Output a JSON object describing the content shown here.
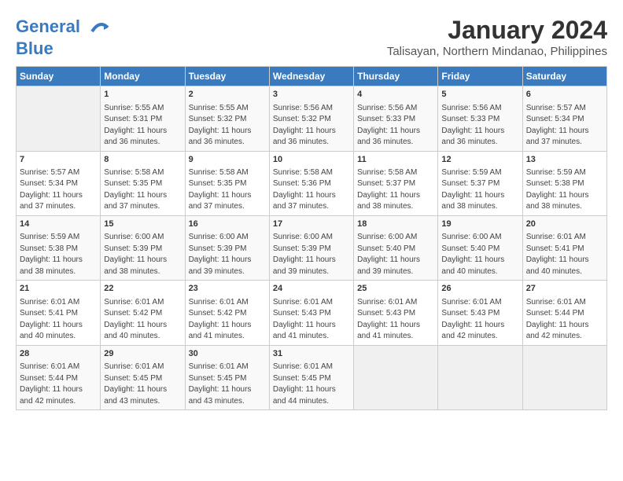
{
  "header": {
    "logo_line1": "General",
    "logo_line2": "Blue",
    "month_year": "January 2024",
    "location": "Talisayan, Northern Mindanao, Philippines"
  },
  "columns": [
    "Sunday",
    "Monday",
    "Tuesday",
    "Wednesday",
    "Thursday",
    "Friday",
    "Saturday"
  ],
  "weeks": [
    [
      {
        "num": "",
        "info": ""
      },
      {
        "num": "1",
        "info": "Sunrise: 5:55 AM\nSunset: 5:31 PM\nDaylight: 11 hours\nand 36 minutes."
      },
      {
        "num": "2",
        "info": "Sunrise: 5:55 AM\nSunset: 5:32 PM\nDaylight: 11 hours\nand 36 minutes."
      },
      {
        "num": "3",
        "info": "Sunrise: 5:56 AM\nSunset: 5:32 PM\nDaylight: 11 hours\nand 36 minutes."
      },
      {
        "num": "4",
        "info": "Sunrise: 5:56 AM\nSunset: 5:33 PM\nDaylight: 11 hours\nand 36 minutes."
      },
      {
        "num": "5",
        "info": "Sunrise: 5:56 AM\nSunset: 5:33 PM\nDaylight: 11 hours\nand 36 minutes."
      },
      {
        "num": "6",
        "info": "Sunrise: 5:57 AM\nSunset: 5:34 PM\nDaylight: 11 hours\nand 37 minutes."
      }
    ],
    [
      {
        "num": "7",
        "info": "Sunrise: 5:57 AM\nSunset: 5:34 PM\nDaylight: 11 hours\nand 37 minutes."
      },
      {
        "num": "8",
        "info": "Sunrise: 5:58 AM\nSunset: 5:35 PM\nDaylight: 11 hours\nand 37 minutes."
      },
      {
        "num": "9",
        "info": "Sunrise: 5:58 AM\nSunset: 5:35 PM\nDaylight: 11 hours\nand 37 minutes."
      },
      {
        "num": "10",
        "info": "Sunrise: 5:58 AM\nSunset: 5:36 PM\nDaylight: 11 hours\nand 37 minutes."
      },
      {
        "num": "11",
        "info": "Sunrise: 5:58 AM\nSunset: 5:37 PM\nDaylight: 11 hours\nand 38 minutes."
      },
      {
        "num": "12",
        "info": "Sunrise: 5:59 AM\nSunset: 5:37 PM\nDaylight: 11 hours\nand 38 minutes."
      },
      {
        "num": "13",
        "info": "Sunrise: 5:59 AM\nSunset: 5:38 PM\nDaylight: 11 hours\nand 38 minutes."
      }
    ],
    [
      {
        "num": "14",
        "info": "Sunrise: 5:59 AM\nSunset: 5:38 PM\nDaylight: 11 hours\nand 38 minutes."
      },
      {
        "num": "15",
        "info": "Sunrise: 6:00 AM\nSunset: 5:39 PM\nDaylight: 11 hours\nand 38 minutes."
      },
      {
        "num": "16",
        "info": "Sunrise: 6:00 AM\nSunset: 5:39 PM\nDaylight: 11 hours\nand 39 minutes."
      },
      {
        "num": "17",
        "info": "Sunrise: 6:00 AM\nSunset: 5:39 PM\nDaylight: 11 hours\nand 39 minutes."
      },
      {
        "num": "18",
        "info": "Sunrise: 6:00 AM\nSunset: 5:40 PM\nDaylight: 11 hours\nand 39 minutes."
      },
      {
        "num": "19",
        "info": "Sunrise: 6:00 AM\nSunset: 5:40 PM\nDaylight: 11 hours\nand 40 minutes."
      },
      {
        "num": "20",
        "info": "Sunrise: 6:01 AM\nSunset: 5:41 PM\nDaylight: 11 hours\nand 40 minutes."
      }
    ],
    [
      {
        "num": "21",
        "info": "Sunrise: 6:01 AM\nSunset: 5:41 PM\nDaylight: 11 hours\nand 40 minutes."
      },
      {
        "num": "22",
        "info": "Sunrise: 6:01 AM\nSunset: 5:42 PM\nDaylight: 11 hours\nand 40 minutes."
      },
      {
        "num": "23",
        "info": "Sunrise: 6:01 AM\nSunset: 5:42 PM\nDaylight: 11 hours\nand 41 minutes."
      },
      {
        "num": "24",
        "info": "Sunrise: 6:01 AM\nSunset: 5:43 PM\nDaylight: 11 hours\nand 41 minutes."
      },
      {
        "num": "25",
        "info": "Sunrise: 6:01 AM\nSunset: 5:43 PM\nDaylight: 11 hours\nand 41 minutes."
      },
      {
        "num": "26",
        "info": "Sunrise: 6:01 AM\nSunset: 5:43 PM\nDaylight: 11 hours\nand 42 minutes."
      },
      {
        "num": "27",
        "info": "Sunrise: 6:01 AM\nSunset: 5:44 PM\nDaylight: 11 hours\nand 42 minutes."
      }
    ],
    [
      {
        "num": "28",
        "info": "Sunrise: 6:01 AM\nSunset: 5:44 PM\nDaylight: 11 hours\nand 42 minutes."
      },
      {
        "num": "29",
        "info": "Sunrise: 6:01 AM\nSunset: 5:45 PM\nDaylight: 11 hours\nand 43 minutes."
      },
      {
        "num": "30",
        "info": "Sunrise: 6:01 AM\nSunset: 5:45 PM\nDaylight: 11 hours\nand 43 minutes."
      },
      {
        "num": "31",
        "info": "Sunrise: 6:01 AM\nSunset: 5:45 PM\nDaylight: 11 hours\nand 44 minutes."
      },
      {
        "num": "",
        "info": ""
      },
      {
        "num": "",
        "info": ""
      },
      {
        "num": "",
        "info": ""
      }
    ]
  ]
}
